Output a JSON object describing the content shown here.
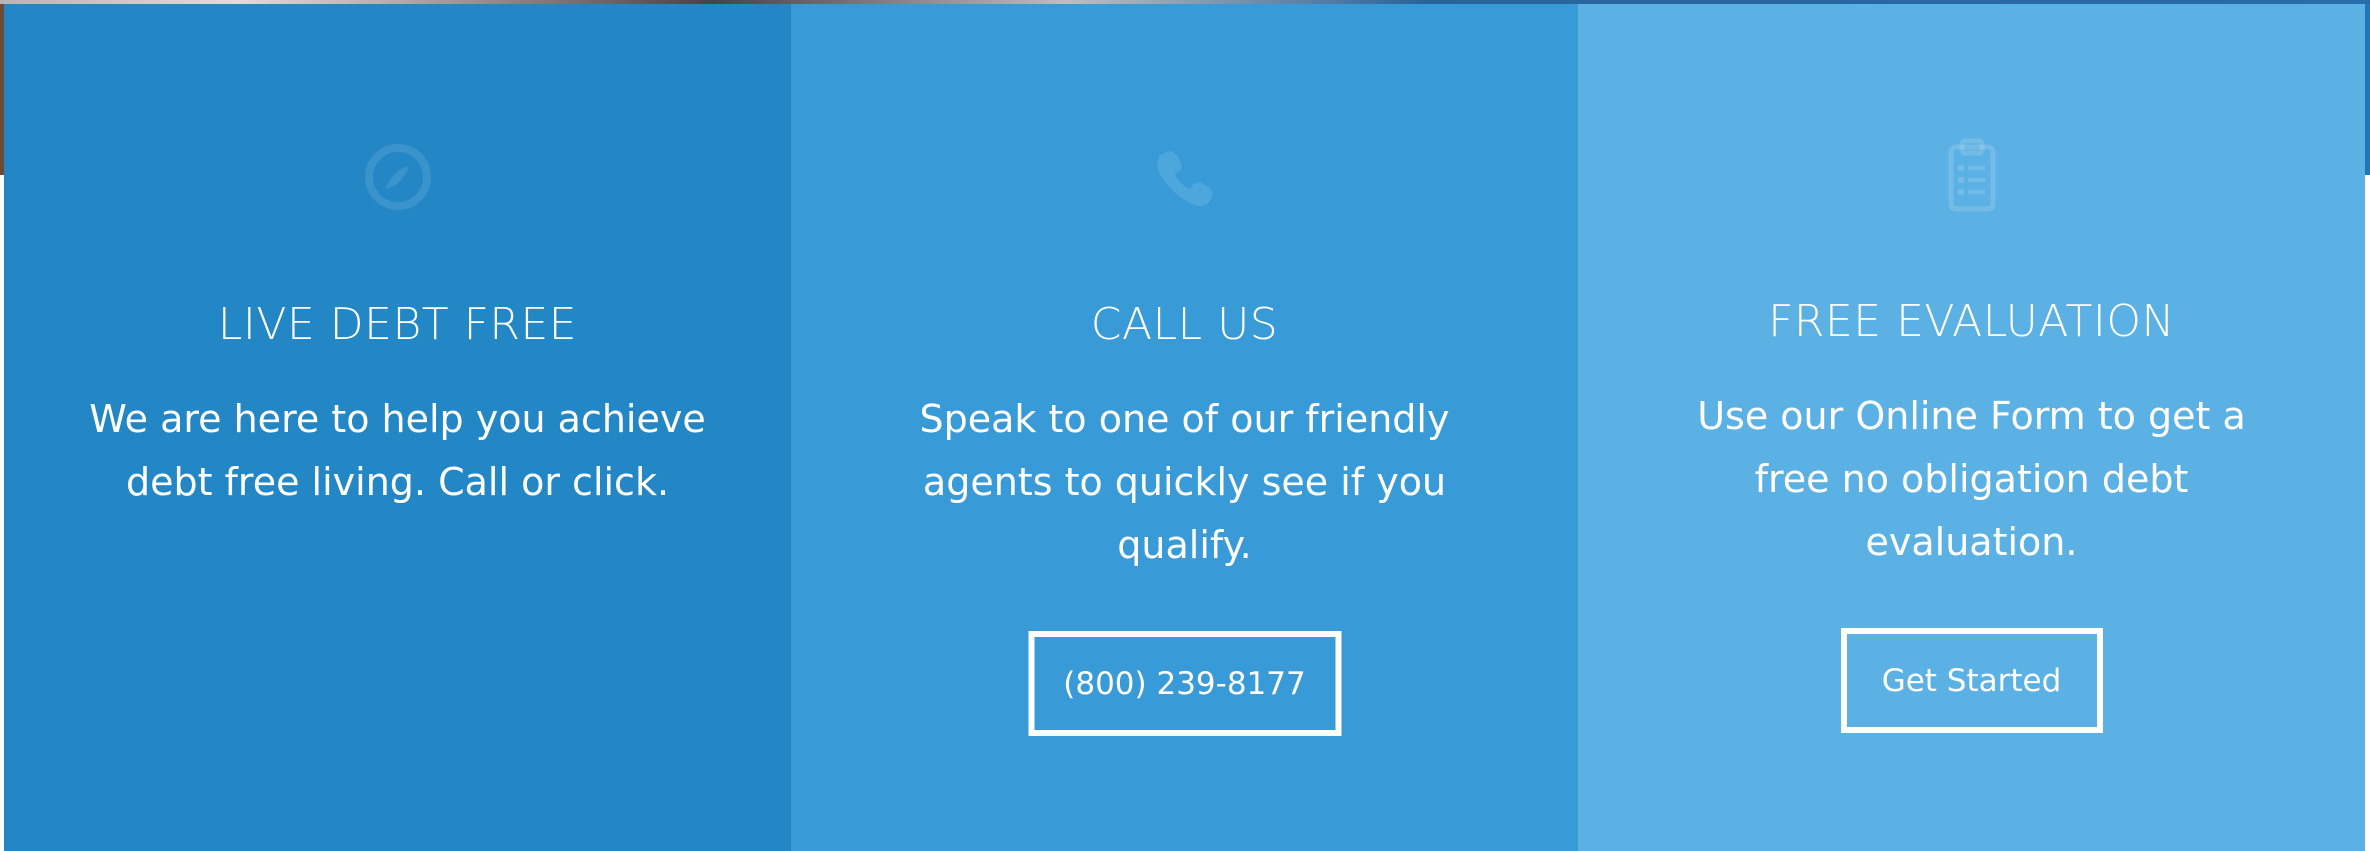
{
  "panels": [
    {
      "icon": "compass-icon",
      "title": "LIVE DEBT FREE",
      "text": "We are here to help you achieve debt free living. Call or click.",
      "color": "#2487c5"
    },
    {
      "icon": "phone-icon",
      "title": "CALL US",
      "text": "Speak to one of our friendly agents to quickly see if you qualify.",
      "button": "(800) 239-8177",
      "color": "#389bd8"
    },
    {
      "icon": "clipboard-icon",
      "title": "FREE EVALUATION",
      "text": "Use our Online Form to get a free no obligation debt evaluation.",
      "button": "Get Started",
      "color": "#5cb1e4"
    }
  ],
  "colors": {
    "icon_tint": "#ffffff"
  }
}
